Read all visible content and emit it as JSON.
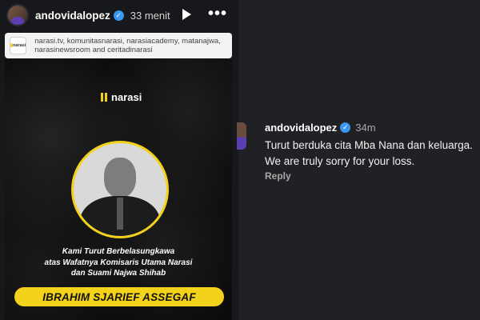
{
  "story": {
    "username": "andovidalopez",
    "time": "33 menit",
    "share_card_text": "narasi.tv, komunitasnarasi, narasiacademy, matanajwa, narasinewsroom and ceritadinarasi",
    "card_logo_text": "narasi",
    "poster": {
      "brand": "narasi",
      "condolence_lines": [
        "Kami Turut Berbelasungkawa",
        "atas Wafatnya Komisaris Utama Narasi",
        "dan Suami Najwa Shihab"
      ],
      "name": "IBRAHIM SJARIEF ASSEGAF"
    }
  },
  "comment": {
    "username": "andovidalopez",
    "time": "34m",
    "text": "Turut berduka cita Mba Nana dan keluarga. We are truly sorry for your loss.",
    "reply_label": "Reply"
  },
  "colors": {
    "accent_yellow": "#f2d21a",
    "verified_blue": "#3897f0",
    "background": "#202124"
  }
}
